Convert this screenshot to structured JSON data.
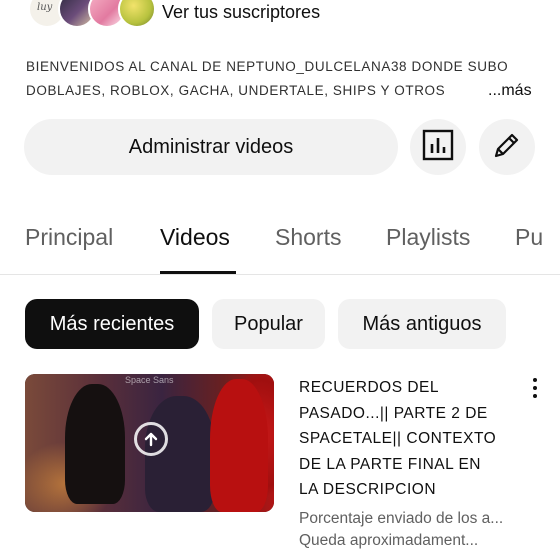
{
  "subscribers": {
    "label": "Ver tus suscriptores",
    "avatar_scribble": "luy"
  },
  "description": {
    "line1": "BIENVENIDOS AL CANAL DE NEPTUNO_DULCELANA38 DONDE SUBO",
    "line2": "DOBLAJES, ROBLOX, GACHA, UNDERTALE, SHIPS Y OTROS",
    "more": "...más"
  },
  "actions": {
    "manage_videos": "Administrar videos",
    "stats_icon": "bar-chart-icon",
    "edit_icon": "pencil-icon"
  },
  "tabs": [
    {
      "label": "Principal",
      "active": false
    },
    {
      "label": "Videos",
      "active": true
    },
    {
      "label": "Shorts",
      "active": false
    },
    {
      "label": "Playlists",
      "active": false
    },
    {
      "label": "Pu",
      "active": false
    }
  ],
  "chips": [
    {
      "label": "Más recientes",
      "selected": true
    },
    {
      "label": "Popular",
      "selected": false
    },
    {
      "label": "Más antiguos",
      "selected": false
    }
  ],
  "video": {
    "title_lines": [
      "RECUERDOS DEL",
      "PASADO...|| PARTE 2 DE",
      "SPACETALE|| CONTEXTO",
      "DE LA PARTE FINAL EN",
      "LA DESCRIPCION"
    ],
    "status_line1": "Porcentaje enviado de los a...",
    "status_line2": "Queda aproximadament...",
    "thumbnail_caption": "Space Sans",
    "upload_icon": "upload-arrow-icon",
    "menu_icon": "more-vertical-icon"
  },
  "colors": {
    "text_primary": "#0f0f0f",
    "text_secondary": "#606060",
    "chip_bg": "#f2f2f2",
    "chip_selected_bg": "#0f0f0f"
  }
}
